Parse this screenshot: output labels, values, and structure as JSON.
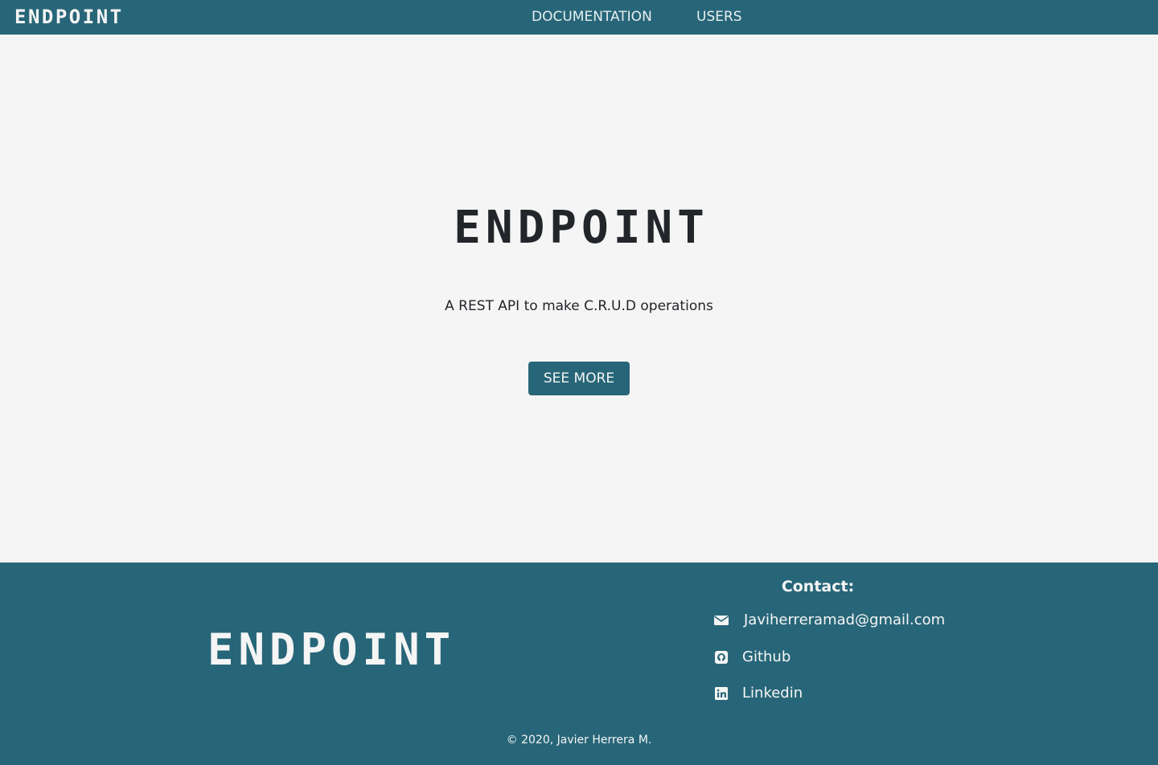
{
  "navbar": {
    "brand": "ENDPOINT",
    "links": [
      {
        "label": "DOCUMENTATION"
      },
      {
        "label": "USERS"
      }
    ]
  },
  "hero": {
    "title": "ENDPOINT",
    "subtitle": "A REST API to make C.R.U.D operations",
    "button_label": "SEE MORE"
  },
  "footer": {
    "logo": "ENDPOINT",
    "contact_heading": "Contact:",
    "contacts": [
      {
        "icon": "envelope-icon",
        "label": "Javiherreramad@gmail.com"
      },
      {
        "icon": "github-icon",
        "label": "Github"
      },
      {
        "icon": "linkedin-icon",
        "label": "Linkedin"
      }
    ],
    "copyright": "© 2020, Javier Herrera M."
  },
  "colors": {
    "primary": "#276678",
    "background": "#f5f5f5",
    "text_dark": "#222529",
    "text_light": "#f5f5f5"
  }
}
